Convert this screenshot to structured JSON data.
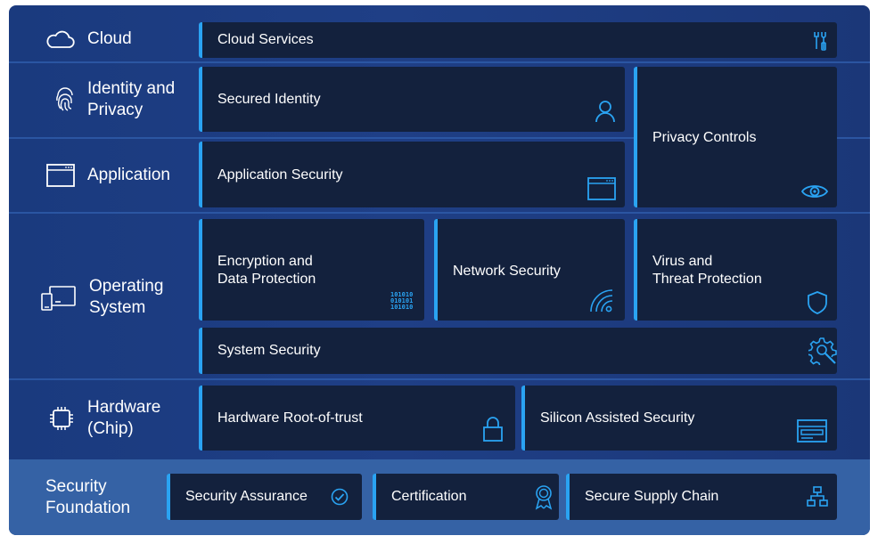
{
  "layers": {
    "cloud": "Cloud",
    "identity": "Identity and\nPrivacy",
    "application": "Application",
    "os": "Operating\nSystem",
    "hardware": "Hardware\n(Chip)",
    "foundation": "Security\nFoundation"
  },
  "boxes": {
    "cloud_services": "Cloud Services",
    "secured_identity": "Secured Identity",
    "privacy_controls": "Privacy Controls",
    "application_security": "Application Security",
    "encryption": "Encryption and\nData Protection",
    "network_security": "Network Security",
    "virus_threat": "Virus and\nThreat Protection",
    "system_security": "System Security",
    "hardware_root": "Hardware Root-of-trust",
    "silicon_security": "Silicon Assisted Security",
    "security_assurance": "Security Assurance",
    "certification": "Certification",
    "supply_chain": "Secure Supply Chain"
  },
  "icons": {
    "cloud": "cloud-icon",
    "identity": "fingerprint-icon",
    "application": "window-icon",
    "os": "devices-icon",
    "hardware": "chip-icon",
    "cloud_services": "tools-icon",
    "secured_identity": "person-icon",
    "privacy_controls": "eye-icon",
    "application_security": "window-icon",
    "encryption": "binary-icon",
    "network_security": "wireless-icon",
    "virus_threat": "shield-icon",
    "system_security": "gear-search-icon",
    "hardware_root": "lock-icon",
    "silicon_security": "board-icon",
    "security_assurance": "check-circle-icon",
    "certification": "certificate-icon",
    "supply_chain": "hierarchy-icon"
  },
  "colors": {
    "background": "#1f3f86",
    "box": "#13213d",
    "accent": "#2aa3f2",
    "foundation": "#3562a5"
  }
}
